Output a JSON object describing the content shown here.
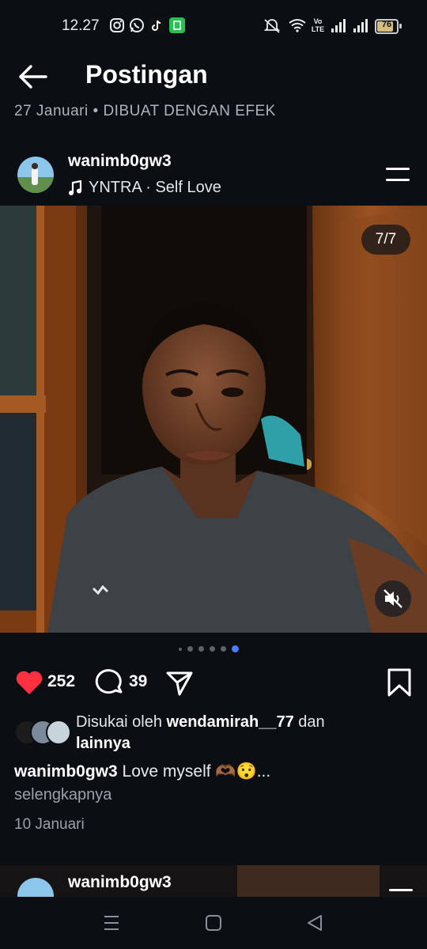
{
  "status_bar": {
    "time": "12.27",
    "network": "Vo LTE",
    "battery": "76",
    "icons": [
      "instagram-icon",
      "whatsapp-icon",
      "tiktok-icon",
      "app-icon",
      "mute-notification-icon",
      "wifi-icon",
      "volte-icon",
      "signal-icon",
      "signal-icon",
      "battery-icon"
    ]
  },
  "header": {
    "title": "Postingan",
    "previous_post_meta": "27 Januari  •  DIBUAT DENGAN EFEK"
  },
  "post": {
    "username": "wanimb0gw3",
    "music": "YNTRA · Self Love",
    "carousel_counter": "7/7",
    "likes": "252",
    "comments": "39",
    "liked_by_prefix": "Disukai oleh ",
    "liked_by_user": "wendamirah__77",
    "liked_by_suffix": " dan",
    "liked_by_others": "lainnya",
    "caption_user": "wanimb0gw3",
    "caption_text": " Love myself 🫶🏾😯...",
    "see_more": "selengkapnya",
    "date": "10 Januari"
  },
  "next_post": {
    "username": "wanimb0gw3"
  },
  "colors": {
    "background": "#0b0f14",
    "like_red": "#ff3040",
    "active_dot": "#4a7cff"
  }
}
